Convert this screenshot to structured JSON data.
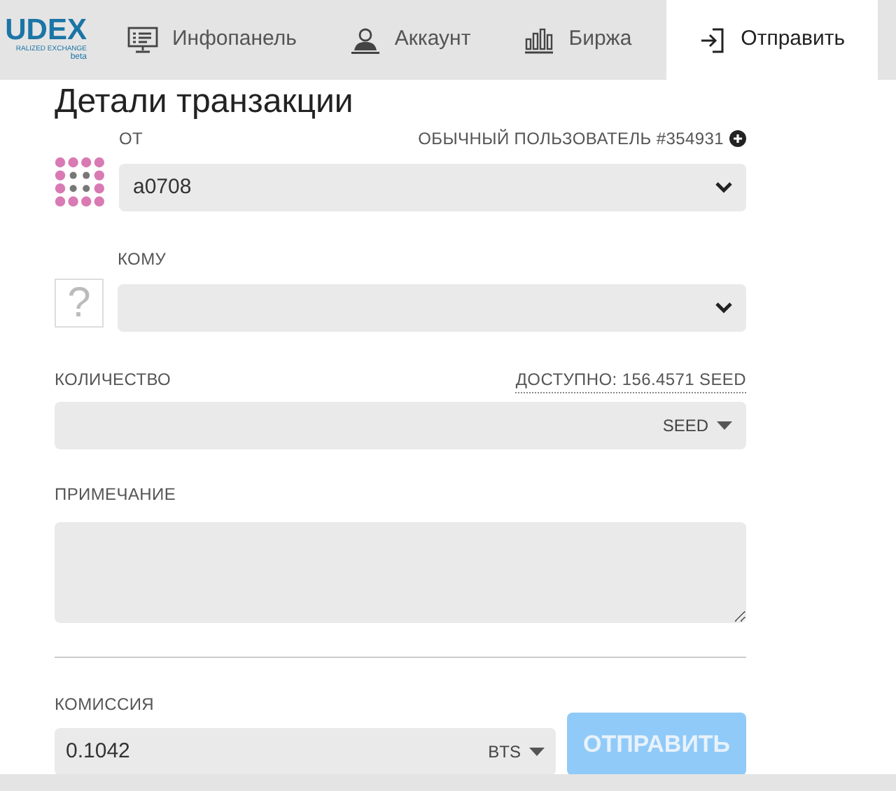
{
  "logo": {
    "name": "UDEX",
    "tagline": "RALIZED EXCHANGE",
    "badge": "beta"
  },
  "tabs": [
    {
      "label": "Инфопанель",
      "kind": "dashboard",
      "selected": false
    },
    {
      "label": "Аккаунт",
      "kind": "account",
      "selected": false
    },
    {
      "label": "Биржа",
      "kind": "exchange",
      "selected": false
    },
    {
      "label": "Отправить",
      "kind": "send",
      "selected": true
    }
  ],
  "heading": "Детали транзакции",
  "from": {
    "label": "ОТ",
    "user_info": "ОБЫЧНЫЙ ПОЛЬЗОВАТЕЛЬ #354931",
    "value": "a0708"
  },
  "to": {
    "label": "КОМУ",
    "avatar": "?"
  },
  "amount": {
    "label": "КОЛИЧЕСТВО",
    "available": "ДОСТУПНО: 156.4571 SEED",
    "asset": "SEED"
  },
  "memo": {
    "label": "ПРИМЕЧАНИЕ"
  },
  "fee": {
    "label": "КОМИССИЯ",
    "value": "0.1042",
    "asset": "BTS"
  },
  "send_button": {
    "label": "ОТПРАВИТЬ",
    "disabled": true
  }
}
